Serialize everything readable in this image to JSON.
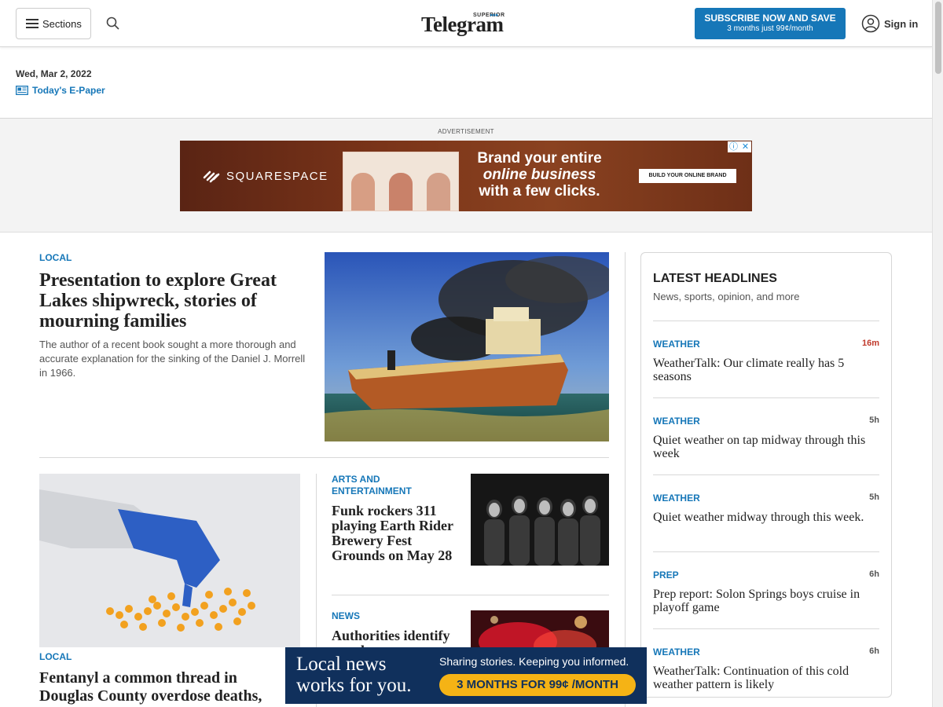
{
  "header": {
    "sections_label": "Sections",
    "logo_small": "SUPERIOR",
    "logo_main": "Telegram",
    "subscribe_line1": "SUBSCRIBE NOW AND SAVE",
    "subscribe_line2": "3 months just 99¢/month",
    "signin_label": "Sign in"
  },
  "dateline": {
    "date": "Wed, Mar 2, 2022",
    "epaper_label": "Today's E-Paper"
  },
  "ad_top": {
    "label": "ADVERTISEMENT",
    "brand": "SQUARESPACE",
    "copy_line1": "Brand your entire",
    "copy_line2": "online business",
    "copy_line3": "with a few clicks.",
    "cta": "BUILD YOUR ONLINE BRAND"
  },
  "main": {
    "lead": {
      "kicker": "LOCAL",
      "headline": "Presentation to explore Great Lakes shipwreck, stories of mourning families",
      "dek": "The author of a recent book sought a more thorough and accurate explanation for the sinking of the Daniel J. Morrell in 1966."
    },
    "story2": {
      "kicker": "LOCAL",
      "headline": "Fentanyl a common thread in Douglas County overdose deaths, officials say"
    },
    "story3": {
      "kicker": "ARTS AND ENTERTAINMENT",
      "headline": "Funk rockers 311 playing Earth Rider Brewery Fest Grounds on May 28"
    },
    "story4": {
      "kicker": "NEWS",
      "headline": "Authorities identify people"
    }
  },
  "sidebar": {
    "title": "LATEST HEADLINES",
    "subtitle": "News, sports, opinion, and more",
    "items": [
      {
        "kicker": "WEATHER",
        "time": "16m",
        "title": "WeatherTalk: Our climate really has 5 seasons"
      },
      {
        "kicker": "WEATHER",
        "time": "5h",
        "title": "Quiet weather on tap midway through this week"
      },
      {
        "kicker": "WEATHER",
        "time": "5h",
        "title": "Quiet weather midway through this week."
      },
      {
        "kicker": "PREP",
        "time": "6h",
        "title": "Prep report: Solon Springs boys cruise in playoff game"
      },
      {
        "kicker": "WEATHER",
        "time": "6h",
        "title": "WeatherTalk: Continuation of this cold weather pattern is likely"
      }
    ]
  },
  "bottom_ad": {
    "headline_line1": "Local news",
    "headline_line2": "works for you.",
    "tagline": "Sharing stories. Keeping you informed.",
    "offer": "3 MONTHS FOR 99¢ /MONTH"
  },
  "colors": {
    "accent": "#1677b8",
    "new_time": "#c0392b",
    "offer_yellow": "#f5b315",
    "ad_navy": "#10305c"
  }
}
